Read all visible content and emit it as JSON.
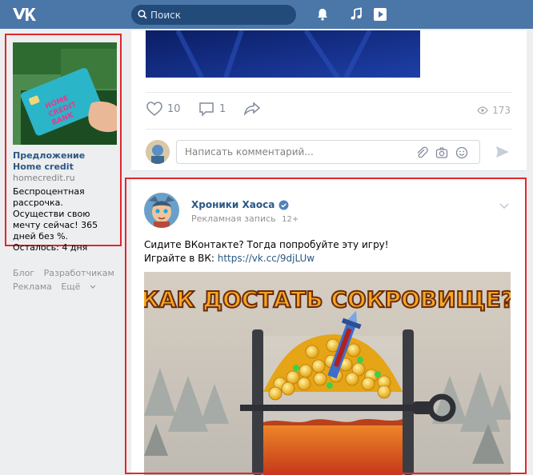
{
  "header": {
    "search_placeholder": "Поиск",
    "icons": [
      "vk-logo",
      "search-icon",
      "bell-icon",
      "music-icon",
      "video-icon"
    ],
    "accent": "#4a76a8"
  },
  "side_ad": {
    "title": "Предложение Home credit",
    "domain": "homecredit.ru",
    "text": "Беспроцентная рассрочка. Осуществи свою мечту сейчас! 365 дней без %. Осталось: 4 дня",
    "card_text": "HOME CREDIT BANK"
  },
  "footer": {
    "links": [
      "Блог",
      "Разработчикам",
      "Реклама",
      "Ещё"
    ]
  },
  "post1": {
    "likes": "10",
    "comments": "1",
    "views": "173",
    "comment_placeholder": "Написать комментарий..."
  },
  "post2": {
    "author": "Хроники Хаоса",
    "sub_label": "Рекламная запись",
    "age": "12+",
    "text_line1": "Сидите ВКонтакте? Тогда попробуйте эту игру!",
    "text_line2_prefix": "Играйте в ВК: ",
    "link": "https://vk.cc/9djLUw",
    "image_caption": "КАК ДОСТАТЬ СОКРОВИЩЕ?"
  },
  "colors": {
    "highlight": "#e0282e",
    "link": "#2a5885",
    "background": "#edeef0"
  }
}
